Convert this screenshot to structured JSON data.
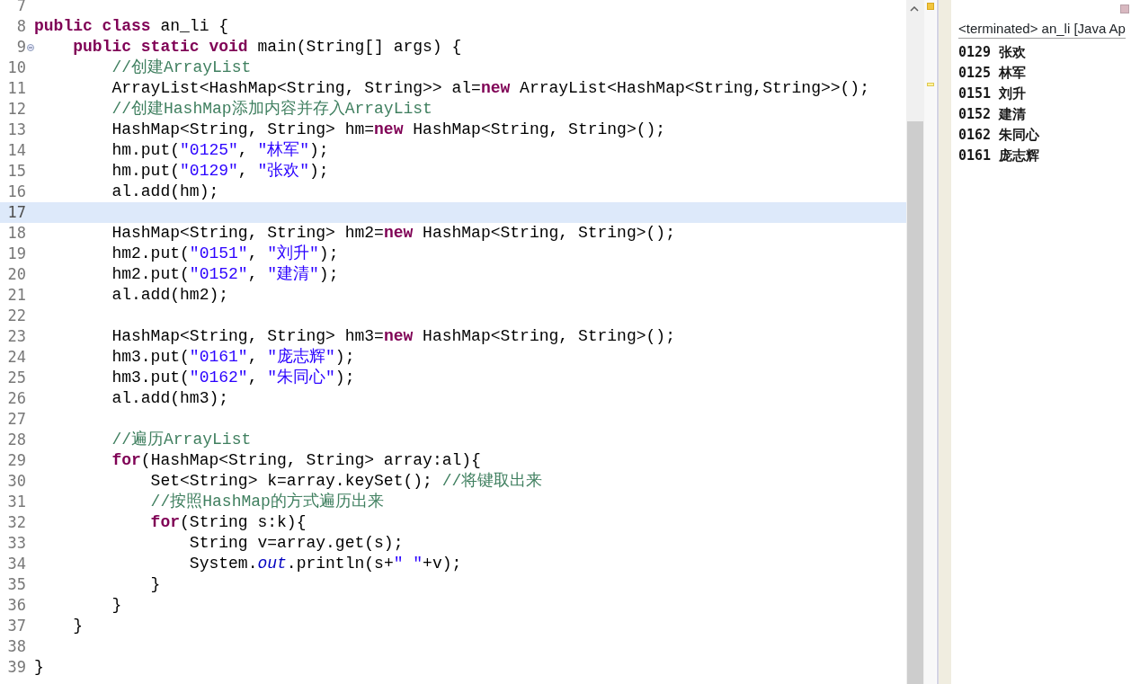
{
  "editor": {
    "lines": [
      {
        "number": "7",
        "fold_marker": false,
        "current": false
      },
      {
        "number": "8",
        "fold_marker": false,
        "current": false,
        "tokens": [
          {
            "kind": "keyword",
            "text": "public class"
          },
          {
            "kind": "plain",
            "text": " an_li {"
          }
        ]
      },
      {
        "number": "9",
        "fold_marker": true,
        "current": false,
        "tokens": [
          {
            "kind": "keyword",
            "text": "    public static void"
          },
          {
            "kind": "plain",
            "text": " main(String[] args) {"
          }
        ]
      },
      {
        "number": "10",
        "fold_marker": false,
        "current": false,
        "tokens": [
          {
            "kind": "comment",
            "text": "        //创建ArrayList"
          }
        ]
      },
      {
        "number": "11",
        "fold_marker": false,
        "current": false,
        "tokens": [
          {
            "kind": "plain",
            "text": "        ArrayList<HashMap<String, String>> al="
          },
          {
            "kind": "keyword",
            "text": "new"
          },
          {
            "kind": "plain",
            "text": " ArrayList<HashMap<String,String>>();"
          }
        ]
      },
      {
        "number": "12",
        "fold_marker": false,
        "current": false,
        "tokens": [
          {
            "kind": "comment",
            "text": "        //创建HashMap添加内容并存入ArrayList"
          }
        ]
      },
      {
        "number": "13",
        "fold_marker": false,
        "current": false,
        "tokens": [
          {
            "kind": "plain",
            "text": "        HashMap<String, String> hm="
          },
          {
            "kind": "keyword",
            "text": "new"
          },
          {
            "kind": "plain",
            "text": " HashMap<String, String>();"
          }
        ]
      },
      {
        "number": "14",
        "fold_marker": false,
        "current": false,
        "tokens": [
          {
            "kind": "plain",
            "text": "        hm.put("
          },
          {
            "kind": "string",
            "text": "\"0125\""
          },
          {
            "kind": "plain",
            "text": ", "
          },
          {
            "kind": "string",
            "text": "\"林军\""
          },
          {
            "kind": "plain",
            "text": ");"
          }
        ]
      },
      {
        "number": "15",
        "fold_marker": false,
        "current": false,
        "tokens": [
          {
            "kind": "plain",
            "text": "        hm.put("
          },
          {
            "kind": "string",
            "text": "\"0129\""
          },
          {
            "kind": "plain",
            "text": ", "
          },
          {
            "kind": "string",
            "text": "\"张欢\""
          },
          {
            "kind": "plain",
            "text": ");"
          }
        ]
      },
      {
        "number": "16",
        "fold_marker": false,
        "current": false,
        "tokens": [
          {
            "kind": "plain",
            "text": "        al.add(hm);"
          }
        ]
      },
      {
        "number": "17",
        "fold_marker": false,
        "current": true
      },
      {
        "number": "18",
        "fold_marker": false,
        "current": false,
        "tokens": [
          {
            "kind": "plain",
            "text": "        HashMap<String, String> hm2="
          },
          {
            "kind": "keyword",
            "text": "new"
          },
          {
            "kind": "plain",
            "text": " HashMap<String, String>();"
          }
        ]
      },
      {
        "number": "19",
        "fold_marker": false,
        "current": false,
        "tokens": [
          {
            "kind": "plain",
            "text": "        hm2.put("
          },
          {
            "kind": "string",
            "text": "\"0151\""
          },
          {
            "kind": "plain",
            "text": ", "
          },
          {
            "kind": "string",
            "text": "\"刘升\""
          },
          {
            "kind": "plain",
            "text": ");"
          }
        ]
      },
      {
        "number": "20",
        "fold_marker": false,
        "current": false,
        "tokens": [
          {
            "kind": "plain",
            "text": "        hm2.put("
          },
          {
            "kind": "string",
            "text": "\"0152\""
          },
          {
            "kind": "plain",
            "text": ", "
          },
          {
            "kind": "string",
            "text": "\"建清\""
          },
          {
            "kind": "plain",
            "text": ");"
          }
        ]
      },
      {
        "number": "21",
        "fold_marker": false,
        "current": false,
        "tokens": [
          {
            "kind": "plain",
            "text": "        al.add(hm2);"
          }
        ]
      },
      {
        "number": "22",
        "fold_marker": false,
        "current": false
      },
      {
        "number": "23",
        "fold_marker": false,
        "current": false,
        "tokens": [
          {
            "kind": "plain",
            "text": "        HashMap<String, String> hm3="
          },
          {
            "kind": "keyword",
            "text": "new"
          },
          {
            "kind": "plain",
            "text": " HashMap<String, String>();"
          }
        ]
      },
      {
        "number": "24",
        "fold_marker": false,
        "current": false,
        "tokens": [
          {
            "kind": "plain",
            "text": "        hm3.put("
          },
          {
            "kind": "string",
            "text": "\"0161\""
          },
          {
            "kind": "plain",
            "text": ", "
          },
          {
            "kind": "string",
            "text": "\"庞志辉\""
          },
          {
            "kind": "plain",
            "text": ");"
          }
        ]
      },
      {
        "number": "25",
        "fold_marker": false,
        "current": false,
        "tokens": [
          {
            "kind": "plain",
            "text": "        hm3.put("
          },
          {
            "kind": "string",
            "text": "\"0162\""
          },
          {
            "kind": "plain",
            "text": ", "
          },
          {
            "kind": "string",
            "text": "\"朱同心\""
          },
          {
            "kind": "plain",
            "text": ");"
          }
        ]
      },
      {
        "number": "26",
        "fold_marker": false,
        "current": false,
        "tokens": [
          {
            "kind": "plain",
            "text": "        al.add(hm3);"
          }
        ]
      },
      {
        "number": "27",
        "fold_marker": false,
        "current": false
      },
      {
        "number": "28",
        "fold_marker": false,
        "current": false,
        "tokens": [
          {
            "kind": "comment",
            "text": "        //遍历ArrayList"
          }
        ]
      },
      {
        "number": "29",
        "fold_marker": false,
        "current": false,
        "tokens": [
          {
            "kind": "keyword",
            "text": "        for"
          },
          {
            "kind": "plain",
            "text": "(HashMap<String, String> array:al){"
          }
        ]
      },
      {
        "number": "30",
        "fold_marker": false,
        "current": false,
        "tokens": [
          {
            "kind": "plain",
            "text": "            Set<String> k=array.keySet(); "
          },
          {
            "kind": "comment",
            "text": "//将键取出来"
          }
        ]
      },
      {
        "number": "31",
        "fold_marker": false,
        "current": false,
        "tokens": [
          {
            "kind": "comment",
            "text": "            //按照HashMap的方式遍历出来"
          }
        ]
      },
      {
        "number": "32",
        "fold_marker": false,
        "current": false,
        "tokens": [
          {
            "kind": "keyword",
            "text": "            for"
          },
          {
            "kind": "plain",
            "text": "(String s:k){"
          }
        ]
      },
      {
        "number": "33",
        "fold_marker": false,
        "current": false,
        "tokens": [
          {
            "kind": "plain",
            "text": "                String v=array.get(s);"
          }
        ]
      },
      {
        "number": "34",
        "fold_marker": false,
        "current": false,
        "tokens": [
          {
            "kind": "plain",
            "text": "                System."
          },
          {
            "kind": "field",
            "text": "out"
          },
          {
            "kind": "plain",
            "text": ".println(s+"
          },
          {
            "kind": "string",
            "text": "\" \""
          },
          {
            "kind": "plain",
            "text": "+v);"
          }
        ]
      },
      {
        "number": "35",
        "fold_marker": false,
        "current": false,
        "tokens": [
          {
            "kind": "plain",
            "text": "            }"
          }
        ]
      },
      {
        "number": "36",
        "fold_marker": false,
        "current": false,
        "tokens": [
          {
            "kind": "plain",
            "text": "        }"
          }
        ]
      },
      {
        "number": "37",
        "fold_marker": false,
        "current": false,
        "tokens": [
          {
            "kind": "plain",
            "text": "    }"
          }
        ]
      },
      {
        "number": "38",
        "fold_marker": false,
        "current": false
      },
      {
        "number": "39",
        "fold_marker": false,
        "current": false,
        "tokens": [
          {
            "kind": "plain",
            "text": "}"
          }
        ]
      }
    ]
  },
  "console": {
    "header": "<terminated> an_li [Java Ap",
    "lines": [
      "0129 张欢",
      "0125 林军",
      "0151 刘升",
      "0152 建清",
      "0162 朱同心",
      "0161 庞志辉"
    ]
  }
}
